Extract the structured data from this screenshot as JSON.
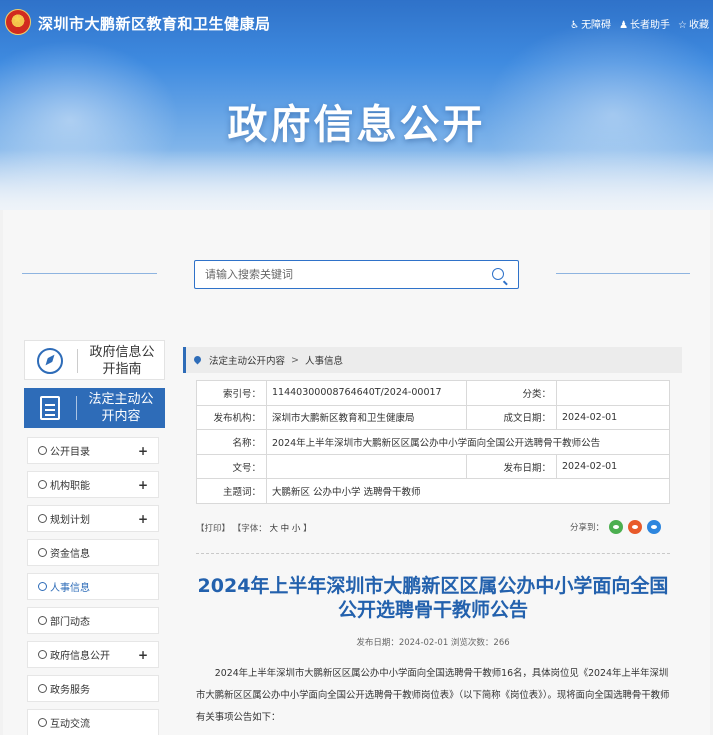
{
  "header": {
    "site_title": "深圳市大鹏新区教育和卫生健康局",
    "banner_title": "政府信息公开",
    "tools": [
      {
        "icon": "accessibility-icon",
        "label": "无障碍"
      },
      {
        "icon": "elder-helper-icon",
        "label": "长者助手"
      },
      {
        "icon": "star-icon",
        "label": "收藏"
      }
    ]
  },
  "search": {
    "placeholder": "请输入搜索关键词"
  },
  "sidebar": {
    "cards": [
      {
        "icon": "compass-icon",
        "label": "政府信息公开指南"
      },
      {
        "icon": "document-icon",
        "label": "法定主动公开内容"
      }
    ],
    "items": [
      {
        "label": "公开目录",
        "expandable": true
      },
      {
        "label": "机构职能",
        "expandable": true
      },
      {
        "label": "规划计划",
        "expandable": true
      },
      {
        "label": "资金信息",
        "expandable": false
      },
      {
        "label": "人事信息",
        "expandable": false,
        "active": true
      },
      {
        "label": "部门动态",
        "expandable": false
      },
      {
        "label": "政府信息公开",
        "expandable": true
      },
      {
        "label": "政务服务",
        "expandable": false
      },
      {
        "label": "互动交流",
        "expandable": false
      }
    ]
  },
  "breadcrumb": {
    "items": [
      "法定主动公开内容",
      "人事信息"
    ],
    "separator": ">"
  },
  "meta": {
    "index_label": "索引号：",
    "index_value": "11440300008764640T/2024-00017",
    "category_label": "分类：",
    "category_value": "",
    "publisher_label": "发布机构：",
    "publisher_value": "深圳市大鹏新区教育和卫生健康局",
    "created_label": "成文日期：",
    "created_value": "2024-02-01",
    "name_label": "名称：",
    "name_value": "2024年上半年深圳市大鹏新区区属公办中小学面向全国公开选聘骨干教师公告",
    "docno_label": "文号：",
    "docno_value": "",
    "published_label": "发布日期：",
    "published_value": "2024-02-01",
    "keywords_label": "主题词：",
    "keywords_value": "大鹏新区 公办中小学 选聘骨干教师"
  },
  "toolbar": {
    "print": "【打印】",
    "font_prefix": "【字体：",
    "font_large": "大",
    "font_medium": "中",
    "font_small": "小",
    "font_suffix": "】",
    "share_label": "分享到："
  },
  "article": {
    "title": "2024年上半年深圳市大鹏新区区属公办中小学面向全国公开选聘骨干教师公告",
    "meta": "发布日期：2024-02-01   浏览次数：266",
    "body": "2024年上半年深圳市大鹏新区区属公办中小学面向全国选聘骨干教师16名，具体岗位见《2024年上半年深圳市大鹏新区区属公办中小学面向全国公开选聘骨干教师岗位表》（以下简称《岗位表》）。现将面向全国选聘骨干教师有关事项公告如下："
  },
  "colors": {
    "primary": "#2e6cb8",
    "title_blue": "#2361ad",
    "banner_top": "#2f72c9"
  }
}
